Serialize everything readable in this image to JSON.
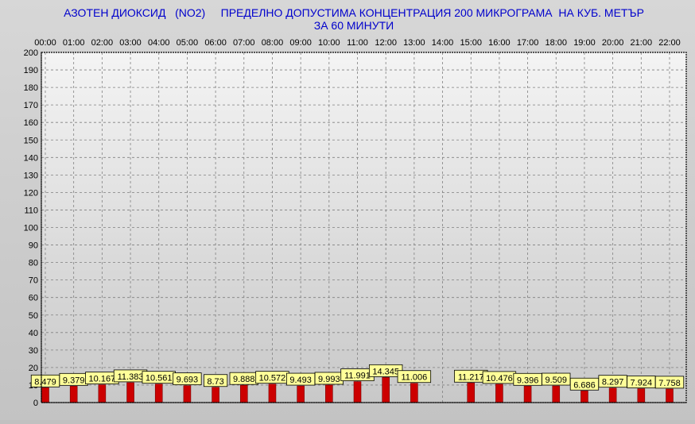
{
  "chart_data": {
    "type": "bar",
    "title": "АЗОТЕН ДИОКСИД   (NO2)     ПРЕДЕЛНО ДОПУСТИМА КОНЦЕНТРАЦИЯ 200 МИКРОГРАМА  НА КУБ. МЕТЪР",
    "subtitle": "ЗА 60 МИНУТИ",
    "xlabel": "",
    "ylabel": "",
    "ylim": [
      0,
      200
    ],
    "y_ticks": [
      0,
      10,
      20,
      30,
      40,
      50,
      60,
      70,
      80,
      90,
      100,
      110,
      120,
      130,
      140,
      150,
      160,
      170,
      180,
      190,
      200
    ],
    "categories": [
      "00:00",
      "01:00",
      "02:00",
      "03:00",
      "04:00",
      "05:00",
      "06:00",
      "07:00",
      "08:00",
      "09:00",
      "10:00",
      "11:00",
      "12:00",
      "13:00",
      "14:00",
      "15:00",
      "16:00",
      "17:00",
      "18:00",
      "19:00",
      "20:00",
      "21:00",
      "22:00"
    ],
    "values": [
      8.479,
      9.379,
      10.167,
      11.383,
      10.561,
      9.693,
      8.73,
      9.888,
      10.572,
      9.493,
      9.993,
      11.991,
      14.345,
      11.006,
      null,
      11.217,
      10.476,
      9.396,
      9.509,
      6.686,
      8.297,
      7.924,
      7.758
    ],
    "labels": [
      "8.479",
      "9.379",
      "10.167",
      "11.383",
      "10.561",
      "9.693",
      "8.73",
      "9.888",
      "10.572",
      "9.493",
      "9.993",
      "11.991",
      "14.345",
      "11.006",
      "",
      "11.217",
      "10.476",
      "9.396",
      "9.509",
      "6.686",
      "8.297",
      "7.924",
      "7.758"
    ],
    "grid": true,
    "colors": {
      "bar": "#cc0000",
      "bar_edge": "#7a0000",
      "label_bg": "#ffff99",
      "title": "#0000cc",
      "grid": "#808080",
      "plot_bg_top": "#f4f4f4",
      "plot_bg_bottom": "#c8c8c8"
    }
  }
}
